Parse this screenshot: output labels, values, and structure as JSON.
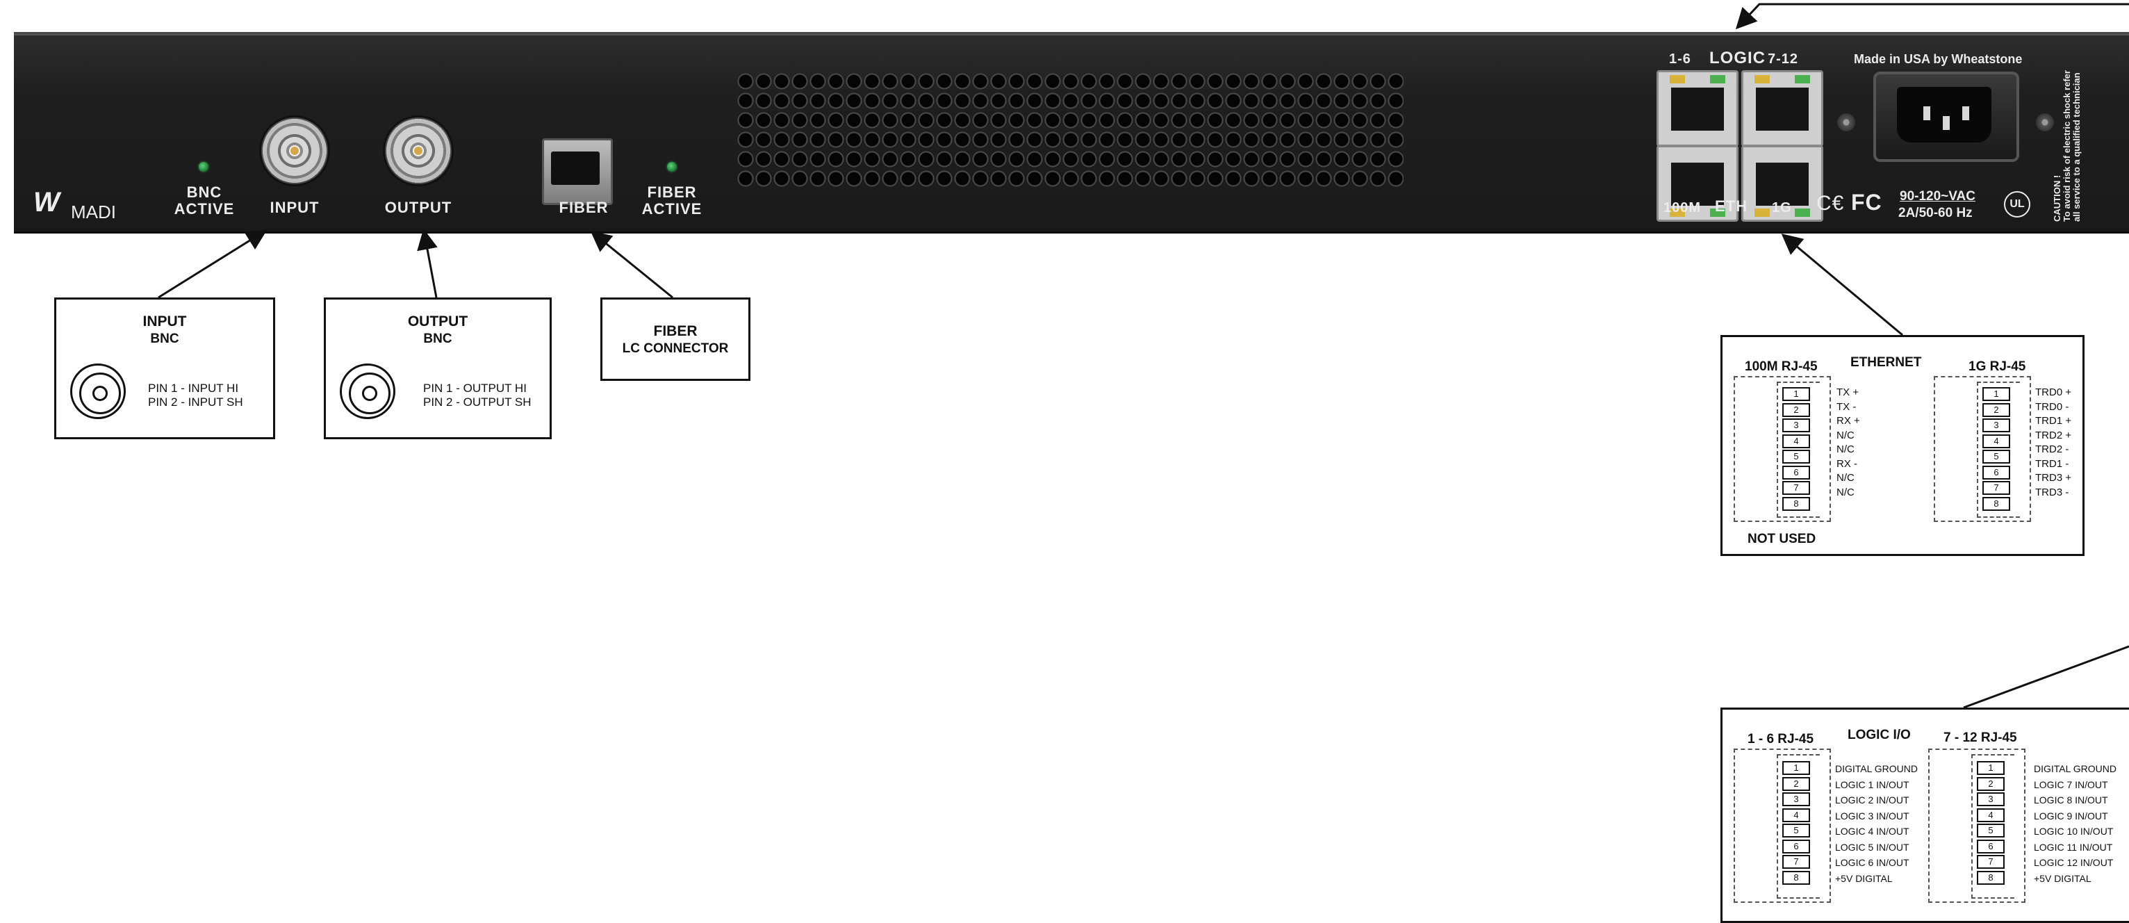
{
  "panel": {
    "brand": "W",
    "model": "MADI",
    "bnc_active": [
      "BNC",
      "ACTIVE"
    ],
    "input": "INPUT",
    "output": "OUTPUT",
    "fiber": "FIBER",
    "fiber_active": [
      "FIBER",
      "ACTIVE"
    ],
    "logic": {
      "left": "1-6",
      "mid": "LOGIC",
      "right": "7-12"
    },
    "eth": {
      "left": "100M",
      "mid": "ETH",
      "right": "1G"
    },
    "made_in": "Made in USA by Wheatstone",
    "voltage": "90-120~VAC",
    "current": "2A/50-60 Hz",
    "cert_ce": "C€",
    "cert_fc": "FC",
    "cert_ul": "UL",
    "caution": [
      "CAUTION !",
      "To avoid risk of electric shock refer",
      "all service to a qualified technician"
    ]
  },
  "input_box": {
    "title": "INPUT",
    "subtitle": "BNC",
    "pins": [
      "PIN 1 - INPUT HI",
      "PIN 2 - INPUT SH"
    ]
  },
  "output_box": {
    "title": "OUTPUT",
    "subtitle": "BNC",
    "pins": [
      "PIN 1 - OUTPUT HI",
      "PIN 2 - OUTPUT SH"
    ]
  },
  "fiber_box": {
    "title": "FIBER",
    "subtitle": "LC CONNECTOR"
  },
  "ethernet_box": {
    "title": "ETHERNET",
    "left_title": "100M RJ-45",
    "right_title": "1G RJ-45",
    "not_used": "NOT USED",
    "pin_numbers": [
      "1",
      "2",
      "3",
      "4",
      "5",
      "6",
      "7",
      "8"
    ],
    "left_pins": [
      "TX +",
      "TX -",
      "RX +",
      "N/C",
      "N/C",
      "RX -",
      "N/C",
      "N/C"
    ],
    "right_pins": [
      "TRD0 +",
      "TRD0 -",
      "TRD1 +",
      "TRD2 +",
      "TRD2 -",
      "TRD1 -",
      "TRD3 +",
      "TRD3 -"
    ]
  },
  "logic_box": {
    "title": "LOGIC I/O",
    "left_title": "1 - 6 RJ-45",
    "right_title": "7 - 12 RJ-45",
    "pin_numbers": [
      "1",
      "2",
      "3",
      "4",
      "5",
      "6",
      "7",
      "8"
    ],
    "left_pins": [
      "DIGITAL GROUND",
      "LOGIC 1 IN/OUT",
      "LOGIC 2 IN/OUT",
      "LOGIC 3 IN/OUT",
      "LOGIC 4 IN/OUT",
      "LOGIC 5 IN/OUT",
      "LOGIC 6 IN/OUT",
      "+5V DIGITAL"
    ],
    "right_pins": [
      "DIGITAL GROUND",
      "LOGIC 7 IN/OUT",
      "LOGIC 8 IN/OUT",
      "LOGIC 9 IN/OUT",
      "LOGIC 10 IN/OUT",
      "LOGIC 11 IN/OUT",
      "LOGIC 12 IN/OUT",
      "+5V DIGITAL"
    ]
  }
}
